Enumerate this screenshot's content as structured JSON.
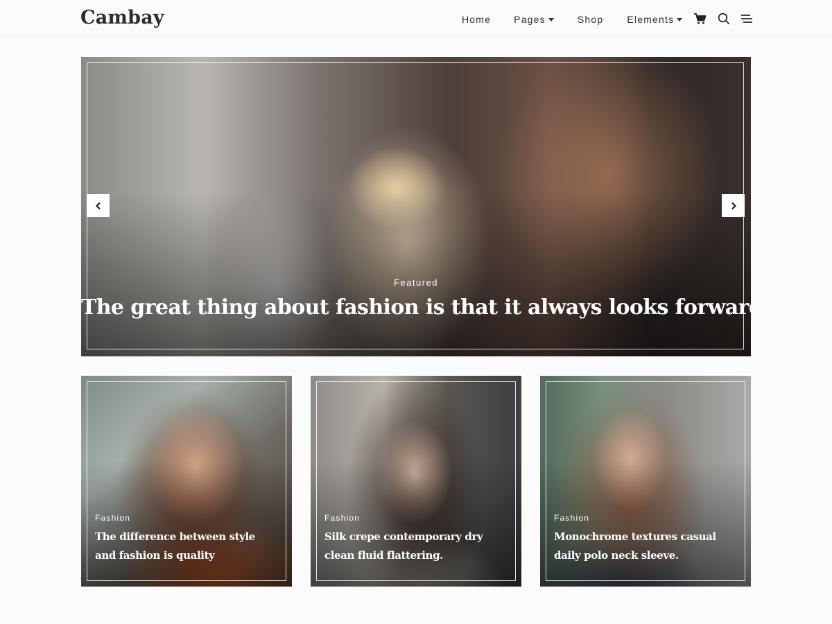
{
  "site": {
    "logo": "Cambay"
  },
  "nav": {
    "items": [
      {
        "label": "Home",
        "has_dropdown": false
      },
      {
        "label": "Pages",
        "has_dropdown": true
      },
      {
        "label": "Shop",
        "has_dropdown": false
      },
      {
        "label": "Elements",
        "has_dropdown": true
      }
    ],
    "icons": [
      "cart-icon",
      "search-icon",
      "menu-icon"
    ]
  },
  "hero": {
    "category": "Featured",
    "title": "The great thing about fashion is that it always looks forward",
    "controls": [
      "chevron-left-icon",
      "chevron-right-icon"
    ]
  },
  "posts": [
    {
      "category": "Fashion",
      "title": "The difference between style and fashion is quality"
    },
    {
      "category": "Fashion",
      "title": "Silk crepe contemporary dry clean fluid flattering."
    },
    {
      "category": "Fashion",
      "title": "Monochrome textures casual daily polo neck sleeve."
    }
  ],
  "colors": {
    "background": "#fbfbfc",
    "text": "#2f2f2f",
    "overlay_text": "#ffffff"
  }
}
